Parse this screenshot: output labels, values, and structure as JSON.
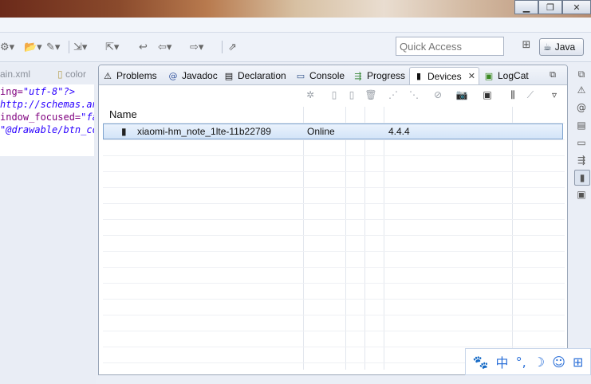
{
  "window": {
    "minimize": "▁",
    "restore": "❐",
    "close": "✕"
  },
  "toolbar": {
    "quick_access": "Quick Access",
    "perspective": "Java"
  },
  "editor": {
    "tabs": [
      "ain.xml",
      "color"
    ],
    "code": [
      {
        "attr": "ing=",
        "str": "\"utf-8\"?>"
      },
      {
        "attr": "",
        "str": "http://schemas.and"
      },
      {
        "attr": "indow_focused=",
        "str": "\"fa"
      },
      {
        "attr": "",
        "str": "\"@drawable/btn_co"
      }
    ]
  },
  "views": {
    "tabs": [
      {
        "label": "Problems",
        "icon": "problems-icon"
      },
      {
        "label": "Javadoc",
        "icon": "javadoc-icon"
      },
      {
        "label": "Declaration",
        "icon": "declaration-icon"
      },
      {
        "label": "Console",
        "icon": "console-icon"
      },
      {
        "label": "Progress",
        "icon": "progress-icon"
      },
      {
        "label": "Devices",
        "icon": "device-icon",
        "active": true
      },
      {
        "label": "LogCat",
        "icon": "logcat-icon"
      }
    ]
  },
  "devices": {
    "columns": [
      "Name",
      "",
      "",
      "",
      ""
    ],
    "rows": [
      {
        "name": "xiaomi-hm_note_1lte-11b22789",
        "state": "Online",
        "version": "4.4.4"
      }
    ]
  },
  "ime": {
    "mode": "中",
    "punct": "°,",
    "moon": "☽",
    "user": "☺",
    "grid": "⊞"
  },
  "colors": {
    "selection": "#d3e4f8",
    "selection_border": "#7da2ce",
    "accent": "#2a6fd8"
  }
}
